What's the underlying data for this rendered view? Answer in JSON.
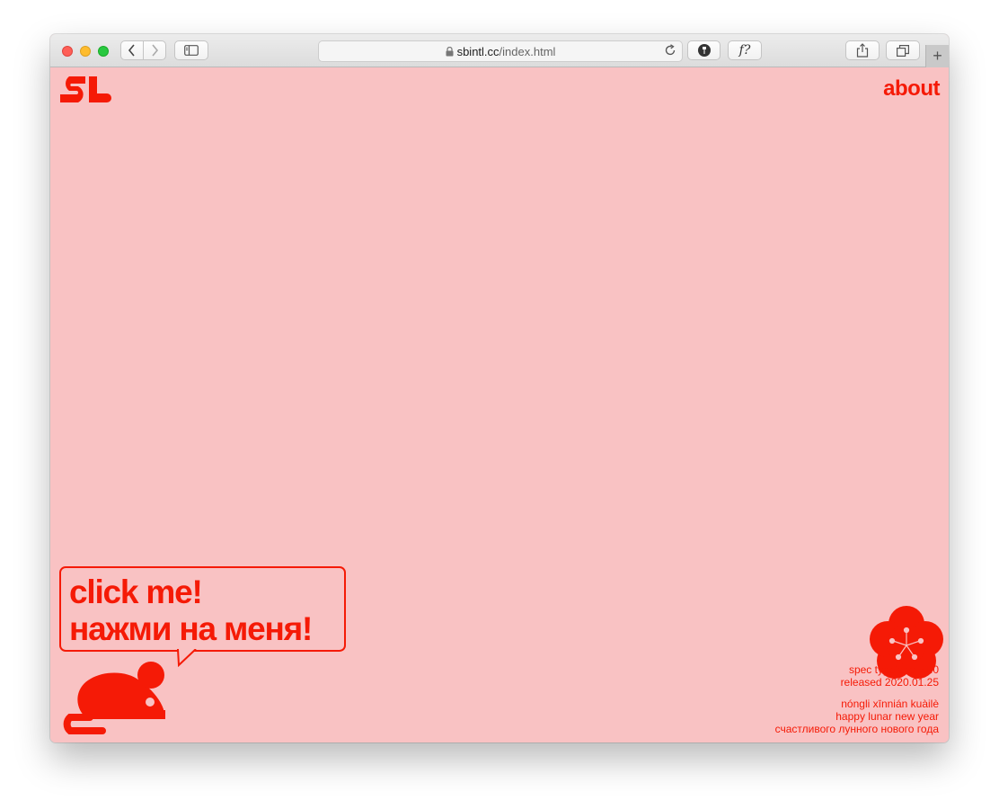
{
  "browser": {
    "url_host": "sbintl.cc",
    "url_path": "/index.html",
    "icons": [
      "back-icon",
      "forward-icon",
      "sidebar-icon",
      "lock-icon",
      "reload-icon",
      "extension-icon",
      "font-icon",
      "share-icon",
      "tabs-icon",
      "add-tab-icon"
    ],
    "font_button_label": "f?",
    "new_tab_label": "+"
  },
  "page": {
    "background": "#f9c2c3",
    "accent": "#f51a06",
    "nav": {
      "about": "about"
    },
    "bubble": {
      "line1": "click me!",
      "line2": "нажми на меня!"
    },
    "info": {
      "typeface": "spec typeface v1.0",
      "released": "released 2020.01.25",
      "pinyin": "nóngli xīnnián kuàilè",
      "english": "happy lunar new year",
      "russian": "счастливого лунного нового года"
    }
  }
}
